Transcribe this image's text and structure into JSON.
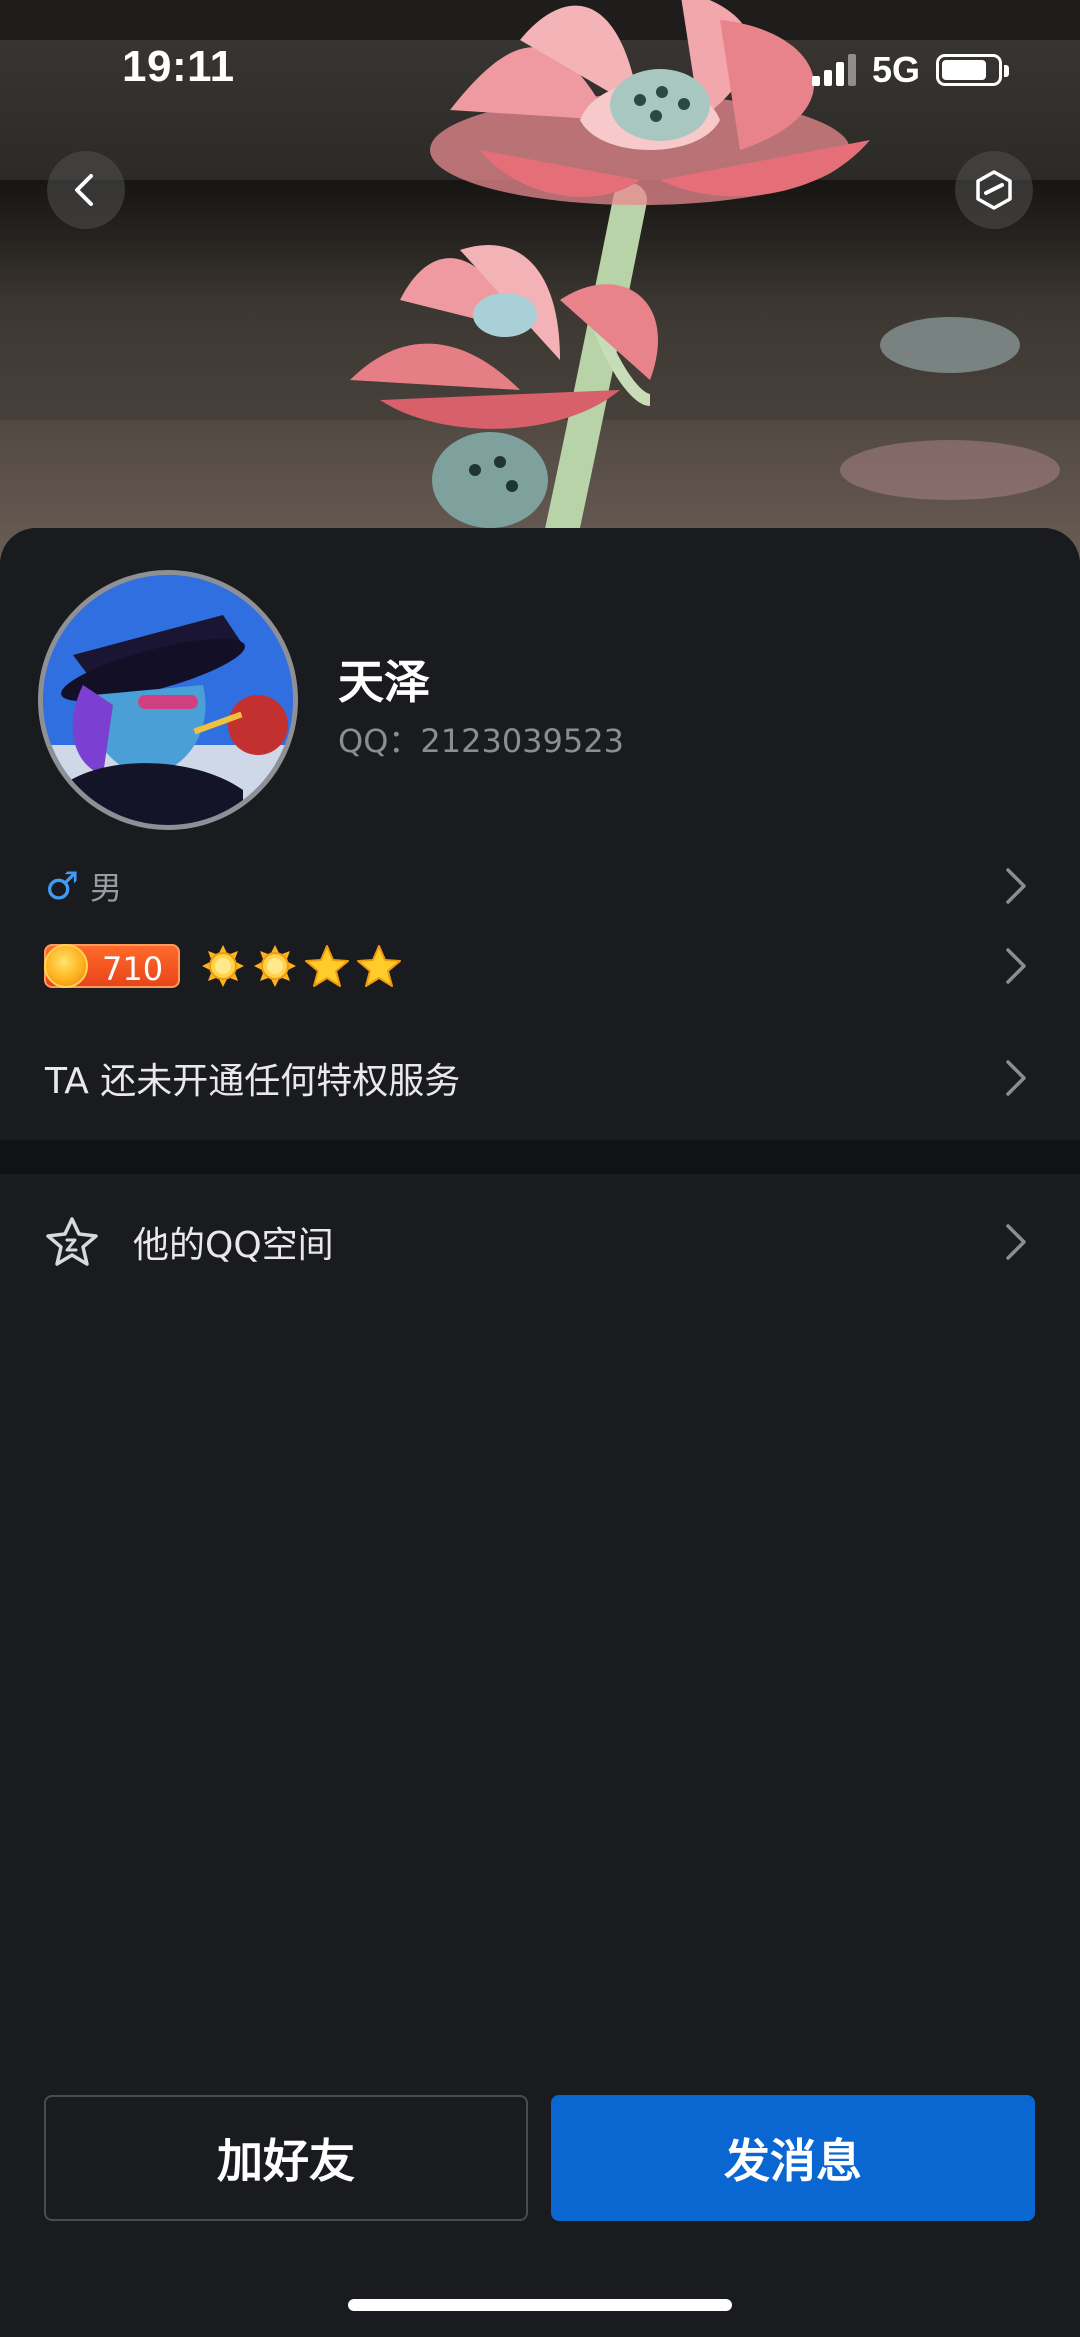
{
  "status_bar": {
    "time": "19:11",
    "network": "5G",
    "icons": [
      "signal-icon",
      "battery-icon"
    ]
  },
  "header": {
    "back_icon": "chevron-left-icon",
    "right_icon": "hexagon-cube-icon"
  },
  "profile": {
    "name": "天泽",
    "qq_label": "QQ：2123039523",
    "gender_symbol": "♂",
    "gender": "男",
    "level": "710",
    "level_badges": [
      "sun-icon",
      "sun-icon",
      "star-icon",
      "star-icon"
    ],
    "privilege_text": "TA 还未开通任何特权服务"
  },
  "links": {
    "qzone_label": "他的QQ空间",
    "qzone_icon": "star-outline-icon"
  },
  "actions": {
    "add_friend": "加好友",
    "send_message": "发消息"
  },
  "colors": {
    "background": "#1a1b1e",
    "primary": "#0a66d0",
    "gender_blue": "#3f9bf3",
    "level_orange": "#e8451a"
  }
}
